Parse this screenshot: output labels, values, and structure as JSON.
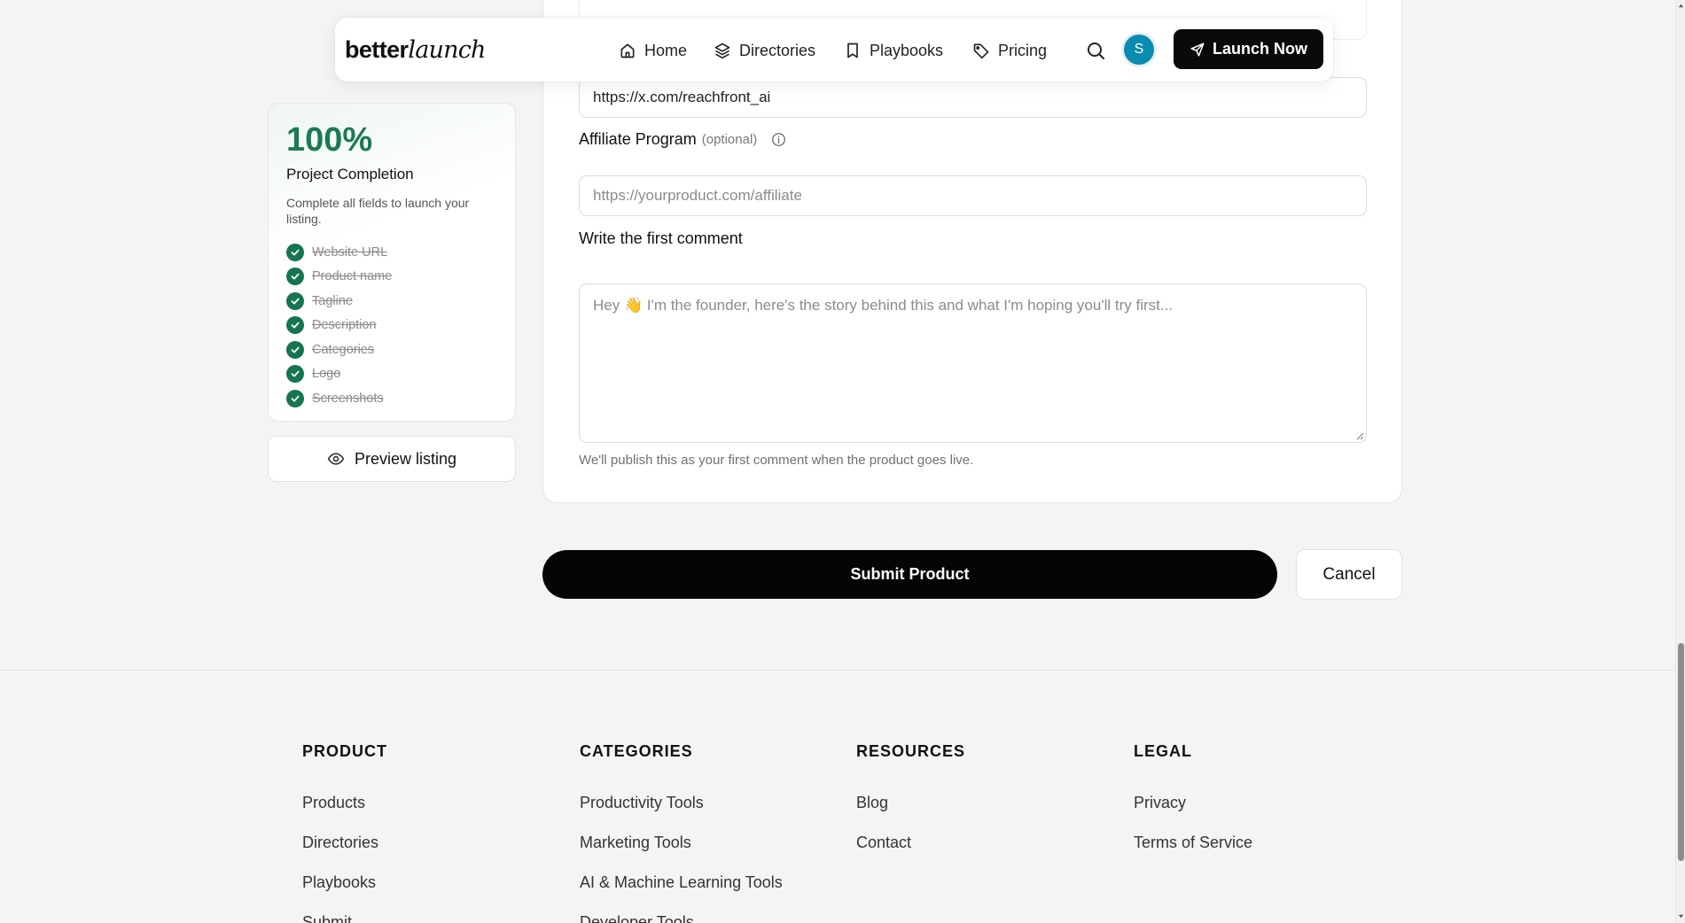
{
  "nav": {
    "logo_bold": "better",
    "logo_italic": "launch",
    "links": [
      {
        "label": "Home",
        "icon": "home-icon"
      },
      {
        "label": "Directories",
        "icon": "layers-icon"
      },
      {
        "label": "Playbooks",
        "icon": "bookmark-icon"
      },
      {
        "label": "Pricing",
        "icon": "tag-icon"
      }
    ],
    "avatar_initial": "S",
    "launch_label": "Launch Now"
  },
  "completion": {
    "percent": "100%",
    "title": "Project Completion",
    "description": "Complete all fields to launch your listing.",
    "items": [
      "Website URL",
      "Product name",
      "Tagline",
      "Description",
      "Categories",
      "Logo",
      "Screenshots"
    ]
  },
  "preview_label": "Preview listing",
  "form": {
    "twitter_value": "https://x.com/reachfront_ai",
    "affiliate_label": "Affiliate Program",
    "affiliate_optional": "(optional)",
    "affiliate_placeholder": "https://yourproduct.com/affiliate",
    "comment_label": "Write the first comment",
    "comment_placeholder": "Hey 👋 I'm the founder, here's the story behind this and what I'm hoping you'll try first...",
    "comment_hint": "We'll publish this as your first comment when the product goes live."
  },
  "actions": {
    "submit_label": "Submit Product",
    "cancel_label": "Cancel"
  },
  "footer": {
    "product": {
      "heading": "PRODUCT",
      "links": [
        "Products",
        "Directories",
        "Playbooks",
        "Submit"
      ]
    },
    "categories": {
      "heading": "CATEGORIES",
      "links": [
        "Productivity Tools",
        "Marketing Tools",
        "AI & Machine Learning Tools",
        "Developer Tools"
      ]
    },
    "resources": {
      "heading": "RESOURCES",
      "links": [
        "Blog",
        "Contact"
      ]
    },
    "legal": {
      "heading": "LEGAL",
      "links": [
        "Privacy",
        "Terms of Service"
      ]
    }
  },
  "colors": {
    "accent_green": "#1b7a54",
    "avatar_bg": "#0b8bb0",
    "primary_button": "#050505",
    "page_bg": "#f5f4f2"
  }
}
